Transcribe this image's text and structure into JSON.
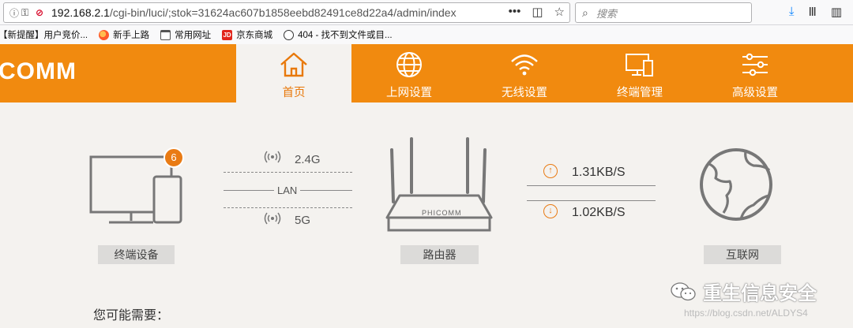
{
  "browser": {
    "url_host": "192.168.2.1",
    "url_path": "/cgi-bin/luci/;stok=31624ac607b1858eebd82491ce8d22a4/admin/index",
    "search_placeholder": "搜索",
    "bookmarks": [
      {
        "label": "【新提醒】用户竞价...",
        "icon": "folder-icon"
      },
      {
        "label": "新手上路",
        "icon": "firefox-icon"
      },
      {
        "label": "常用网址",
        "icon": "folder-icon"
      },
      {
        "label": "京东商城",
        "icon": "jd-icon"
      },
      {
        "label": "404 - 找不到文件或目...",
        "icon": "globe-icon"
      }
    ],
    "jd_icon_text": "JD"
  },
  "router": {
    "logo": "COMM",
    "nav": [
      {
        "label": "首页",
        "icon": "home-icon",
        "active": true
      },
      {
        "label": "上网设置",
        "icon": "globe-icon"
      },
      {
        "label": "无线设置",
        "icon": "wifi-icon"
      },
      {
        "label": "终端管理",
        "icon": "devices-icon"
      },
      {
        "label": "高级设置",
        "icon": "sliders-icon"
      }
    ],
    "colors": {
      "accent": "#f18a0f",
      "badge": "#e97b14"
    }
  },
  "dashboard": {
    "devices": {
      "label": "终端设备",
      "count": "6"
    },
    "bands": {
      "band1": "2.4G",
      "lan": "LAN",
      "band2": "5G"
    },
    "router": {
      "label": "路由器",
      "brand": "PHICOMM"
    },
    "speeds": {
      "up": "1.31KB/S",
      "down": "1.02KB/S"
    },
    "internet": {
      "label": "互联网"
    },
    "need_title": "您可能需要："
  },
  "overlay": {
    "watermark": "重生信息安全",
    "blog": "https://blog.csdn.net/ALDYS4"
  }
}
